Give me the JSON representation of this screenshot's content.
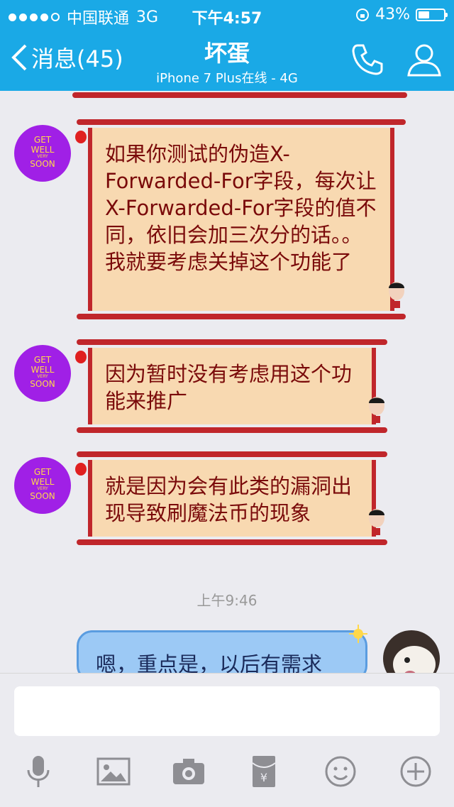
{
  "status_bar": {
    "carrier": "中国联通",
    "network": "3G",
    "time": "下午4:57",
    "battery": "43%",
    "battery_level": 0.43
  },
  "header": {
    "back_label": "消息(45)",
    "title": "坏蛋",
    "subtitle": "iPhone 7 Plus在线 - 4G"
  },
  "contact_avatar": {
    "line1": "GET",
    "line2": "WELL",
    "line3": "VERY",
    "line4": "SOON"
  },
  "messages": [
    {
      "from": "other",
      "text": "如果你测试的伪造X-Forwarded-For字段，每次让X-Forwarded-For字段的值不同，依旧会加三次分的话。。我就要考虑关掉这个功能了"
    },
    {
      "from": "other",
      "text": "因为暂时没有考虑用这个功能来推广"
    },
    {
      "from": "other",
      "text": "就是因为会有此类的漏洞出现导致刷魔法币的现象"
    }
  ],
  "timestamp": "上午9:46",
  "my_message": "嗯，重点是，以后有需求",
  "colors": {
    "header_blue": "#1aa9e6",
    "scroll_red": "#c0262b",
    "scroll_fill": "#f8d9b1",
    "scroll_text": "#7a0a0a",
    "my_bubble": "#9cc9f5"
  },
  "icons": [
    "back-chevron-icon",
    "phone-icon",
    "profile-icon",
    "mic-icon",
    "image-icon",
    "camera-icon",
    "red-packet-icon",
    "emoji-icon",
    "plus-icon"
  ]
}
